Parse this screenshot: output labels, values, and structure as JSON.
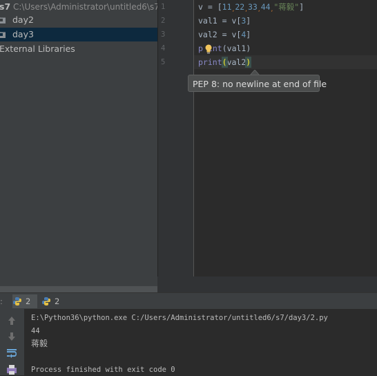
{
  "project_tree": {
    "root_name": "s7",
    "root_path": "C:\\Users\\Administrator\\untitled6\\s7",
    "items": [
      {
        "label": "day2",
        "icon": "folder-icon"
      },
      {
        "label": "day3",
        "icon": "folder-icon",
        "selected": true
      },
      {
        "label": "External Libraries",
        "icon": "external-libraries-icon"
      }
    ]
  },
  "editor": {
    "line_numbers": [
      "1",
      "2",
      "3",
      "4",
      "5"
    ],
    "lines": {
      "l1": {
        "a": "v = [",
        "n1": "11",
        "n2": "22",
        "n3": "33",
        "n4": "44",
        "s": "\"蒋毅\"",
        "b": "]",
        "comma": ","
      },
      "l2": {
        "a": "val1 = v[",
        "n": "3",
        "b": "]"
      },
      "l3": {
        "a": "val2 = v[",
        "n": "4",
        "b": "]"
      },
      "l4": {
        "kw_pre": "p",
        "kw_post": "int",
        "a": "(val1)"
      },
      "l5": {
        "kw": "print",
        "open": "(",
        "arg": "val2",
        "close": ")"
      }
    },
    "tooltip": "PEP 8: no newline at end of file"
  },
  "run_window": {
    "tab_prefix": ":",
    "tabs": [
      {
        "label": "2",
        "icon": "python-icon",
        "active": true
      },
      {
        "label": "2",
        "icon": "python-icon",
        "active": false
      }
    ],
    "toolbar": [
      "scroll-up-icon",
      "scroll-down-icon",
      "soft-wrap-icon",
      "print-icon"
    ],
    "console_lines": [
      "E:\\Python36\\python.exe C:/Users/Administrator/untitled6/s7/day3/2.py",
      "44",
      "蒋毅",
      "",
      "Process finished with exit code 0"
    ]
  },
  "colors": {
    "background": "#2b2b2b",
    "panel": "#3c3f41",
    "selection": "#0d293e",
    "number": "#6897bb",
    "string": "#6a8759",
    "builtin": "#8888c6"
  }
}
